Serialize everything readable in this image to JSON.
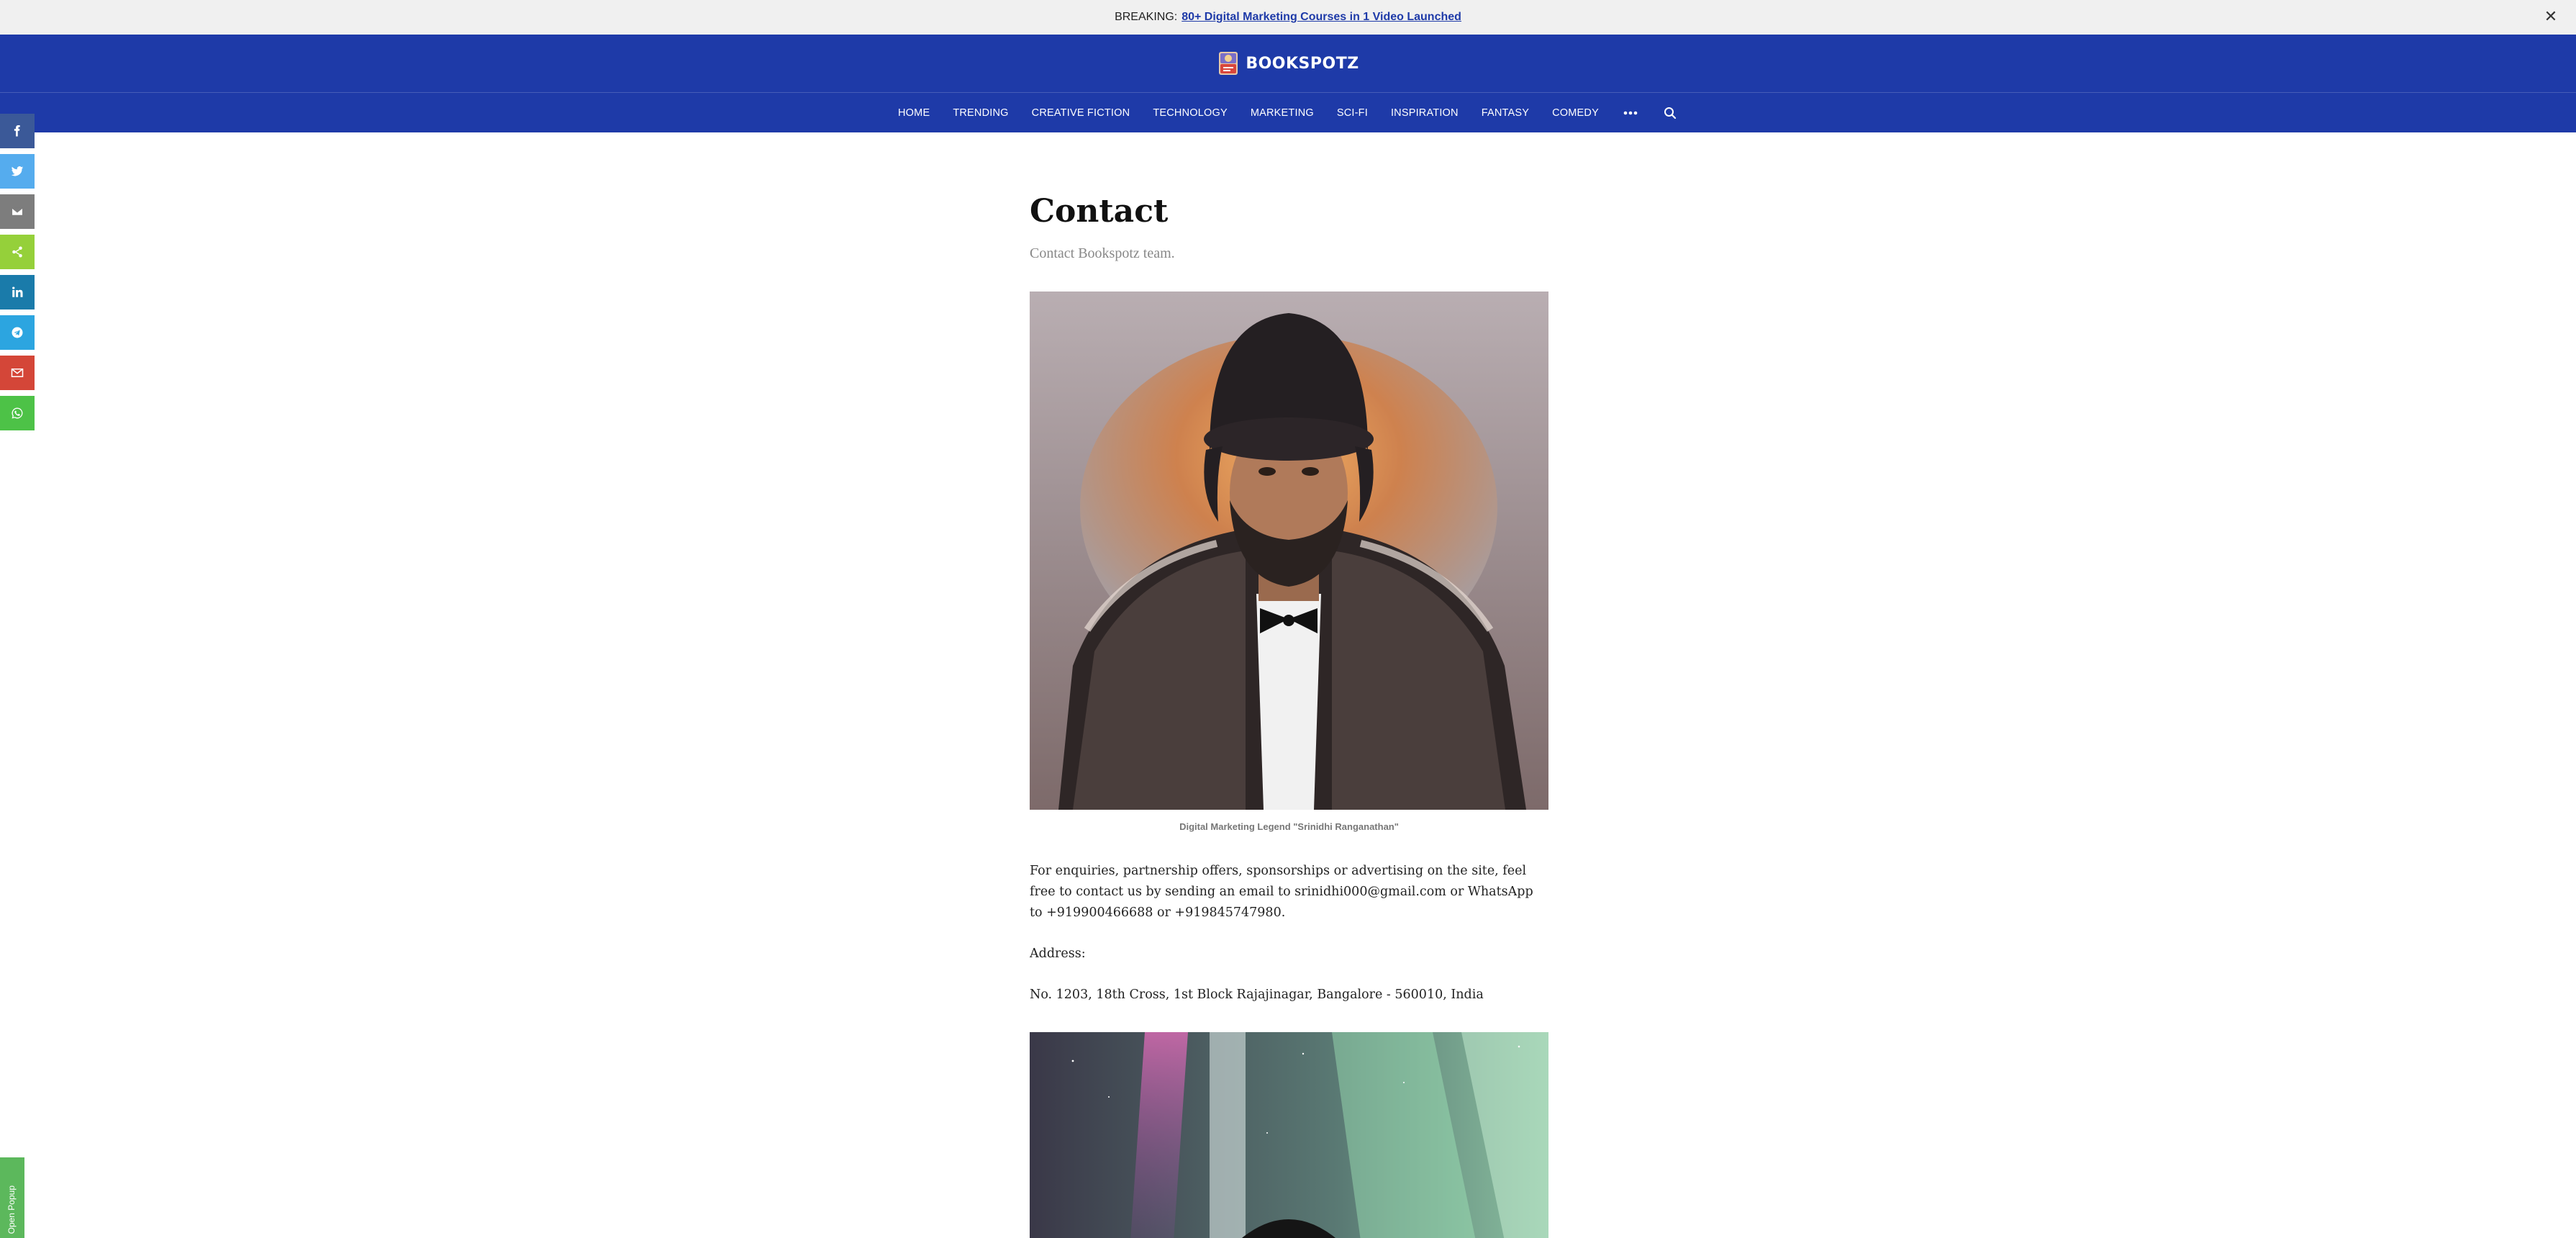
{
  "breaking": {
    "label": "BREAKING:",
    "link_text": "80+ Digital Marketing Courses in 1 Video Launched",
    "close_glyph": "✕"
  },
  "header": {
    "logo_text": "BOOKSPOTZ",
    "bg_color": "#1e3aa8",
    "nav": [
      "HOME",
      "TRENDING",
      "CREATIVE FICTION",
      "TECHNOLOGY",
      "MARKETING",
      "SCI-FI",
      "INSPIRATION",
      "FANTASY",
      "COMEDY"
    ],
    "more_icon": "more-dots-icon",
    "search_icon": "search-icon"
  },
  "social": [
    {
      "name": "facebook",
      "color": "#3b5998"
    },
    {
      "name": "twitter",
      "color": "#55acee"
    },
    {
      "name": "email",
      "color": "#7d7d7d"
    },
    {
      "name": "share",
      "color": "#95d03a"
    },
    {
      "name": "linkedin",
      "color": "#1a7baa"
    },
    {
      "name": "telegram",
      "color": "#2ca5e0"
    },
    {
      "name": "gmail",
      "color": "#d44638"
    },
    {
      "name": "whatsapp",
      "color": "#4dc247"
    }
  ],
  "page": {
    "title": "Contact",
    "subtitle": "Contact Bookspotz team.",
    "caption": "Digital Marketing Legend \"Srinidhi Ranganathan\"",
    "para1": "For enquiries, partnership offers, sponsorships or advertising on the site, feel free to contact us by sending an email to srinidhi000@gmail.com or WhatsApp to +919900466688 or +919845747980.",
    "para2": "Address:",
    "para3": "No. 1203, 18th Cross, 1st Block Rajajinagar, Bangalore - 560010, India"
  },
  "popup": {
    "label": "Open Popup",
    "color": "#5cb85c"
  }
}
